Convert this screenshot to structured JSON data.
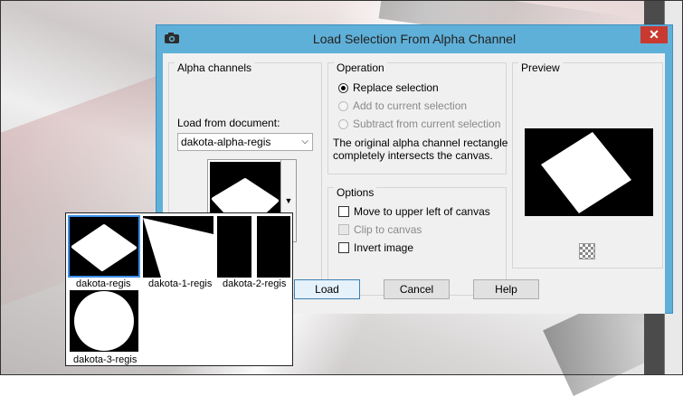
{
  "dialog": {
    "title": "Load Selection From Alpha Channel",
    "close_glyph": "✕",
    "icon": "camera-icon"
  },
  "alpha_channels": {
    "group_label": "Alpha channels",
    "load_from_label": "Load from document:",
    "document_value": "dakota-alpha-regis"
  },
  "operation": {
    "group_label": "Operation",
    "options": [
      {
        "label": "Replace selection",
        "selected": true,
        "enabled": true
      },
      {
        "label": "Add to current selection",
        "selected": false,
        "enabled": false
      },
      {
        "label": "Subtract from current selection",
        "selected": false,
        "enabled": false
      }
    ],
    "info_line1": "The original alpha channel rectangle",
    "info_line2": "completely intersects the canvas."
  },
  "options": {
    "group_label": "Options",
    "items": [
      {
        "label": "Move to upper left of canvas",
        "checked": false,
        "enabled": true
      },
      {
        "label": "Clip to canvas",
        "checked": false,
        "enabled": false
      },
      {
        "label": "Invert image",
        "checked": false,
        "enabled": true
      }
    ]
  },
  "preview": {
    "group_label": "Preview",
    "icon": "checkerboard-icon"
  },
  "buttons": {
    "load": "Load",
    "cancel": "Cancel",
    "help": "Help"
  },
  "popup": {
    "channels": [
      {
        "name": "dakota-regis",
        "selected": true
      },
      {
        "name": "dakota-1-regis",
        "selected": false
      },
      {
        "name": "dakota-2-regis",
        "selected": false
      },
      {
        "name": "dakota-3-regis",
        "selected": false
      }
    ]
  },
  "colors": {
    "title_bar": "#5fb0d8",
    "close_button": "#c83a30",
    "selection_highlight": "#3a8ee6"
  }
}
